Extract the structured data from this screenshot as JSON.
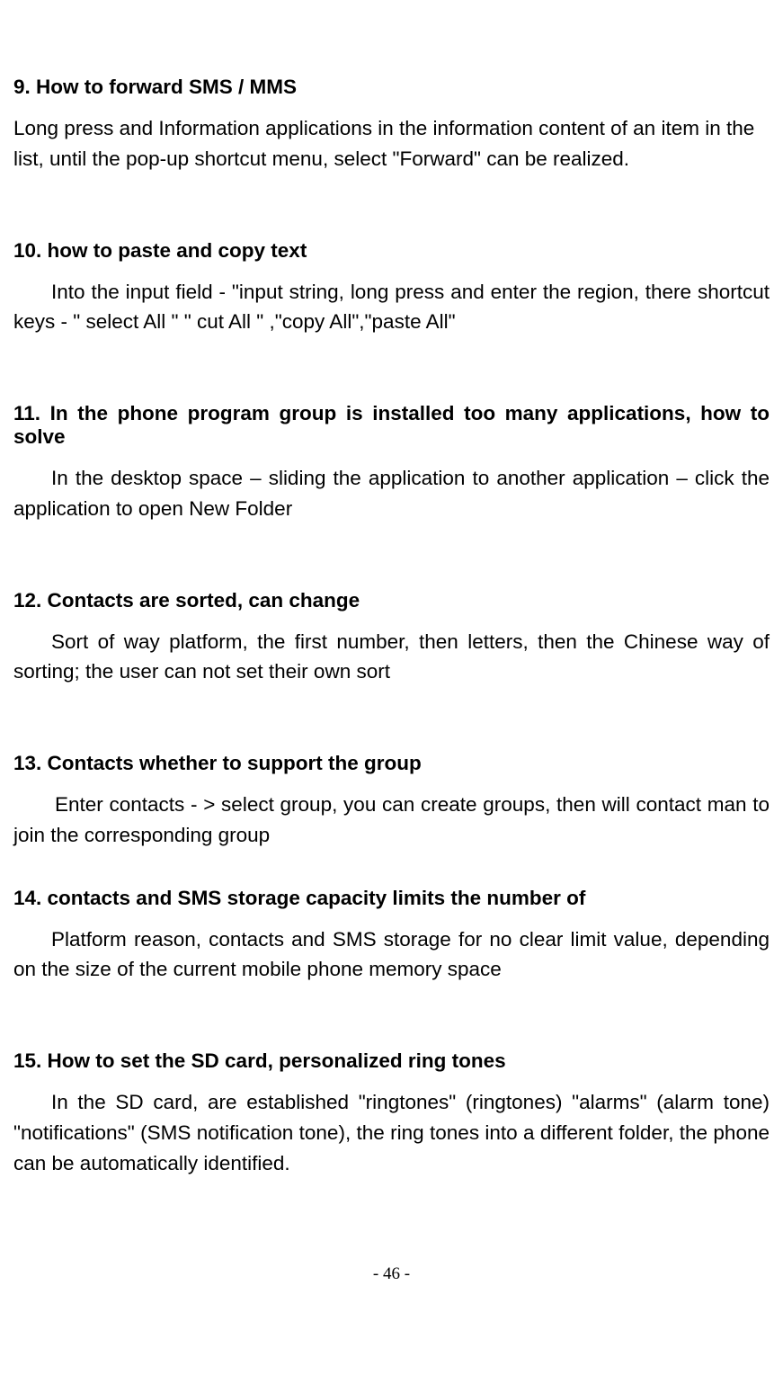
{
  "sections": {
    "s9": {
      "heading": "9. How to forward SMS / MMS",
      "body": "Long press and Information applications in the information content of an item in the list, until the pop-up shortcut menu, select \"Forward\" can be realized."
    },
    "s10": {
      "heading": "10. how to paste and copy text",
      "body": "Into the input field - \"input string, long press and enter the region, there shortcut keys - \" select All \" \" cut All \" ,\"copy All\",\"paste All\""
    },
    "s11": {
      "heading": "11. In the phone program group is installed too many applications, how to solve",
      "body": "In the desktop space – sliding the application to another application – click the application to open New Folder"
    },
    "s12": {
      "heading": "12. Contacts are sorted, can change",
      "body": "Sort of way platform, the first number, then letters, then the Chinese way of sorting; the user can not set their own sort"
    },
    "s13": {
      "heading": "13. Contacts whether to support the group",
      "body": "Enter contacts - > select group, you can create groups, then will contact man to join the corresponding group"
    },
    "s14": {
      "heading": "14. contacts and SMS storage capacity limits the number of",
      "body": "Platform reason, contacts and SMS storage for no clear limit value, depending on the size of the current mobile phone memory space"
    },
    "s15": {
      "heading": "15. How to set the SD card, personalized ring tones",
      "body": "In the SD card, are established \"ringtones\" (ringtones) \"alarms\" (alarm tone) \"notifications\" (SMS notification tone), the ring tones into a different folder, the phone can be automatically identified."
    }
  },
  "pageNumber": "- 46 -"
}
